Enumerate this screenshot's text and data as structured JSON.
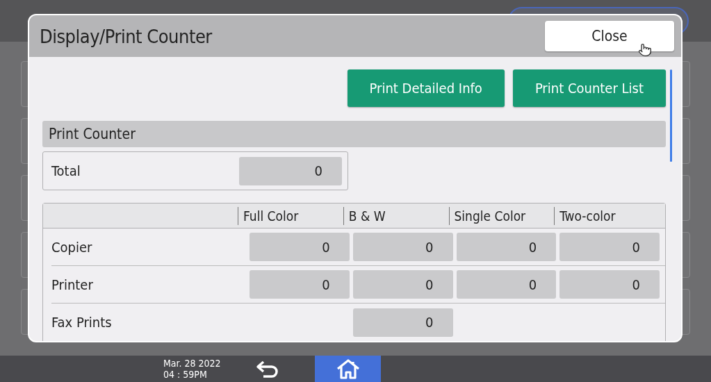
{
  "dialog": {
    "title": "Display/Print Counter",
    "close_button": "Close"
  },
  "actions": [
    "Print Detailed Info",
    "Print Counter List"
  ],
  "section": {
    "title": "Print Counter"
  },
  "total": {
    "label": "Total",
    "value": "0"
  },
  "table": {
    "columns": [
      "Full Color",
      "B & W",
      "Single Color",
      "Two-color"
    ],
    "rows": [
      {
        "label": "Copier",
        "cells": [
          "0",
          "0",
          "0",
          "0"
        ]
      },
      {
        "label": "Printer",
        "cells": [
          "0",
          "0",
          "0",
          "0"
        ]
      },
      {
        "label": "Fax Prints",
        "cells": [
          null,
          "0",
          null,
          null
        ]
      }
    ]
  },
  "status_bar": {
    "date": "Mar. 28 2022",
    "time": "04 : 59PM"
  }
}
